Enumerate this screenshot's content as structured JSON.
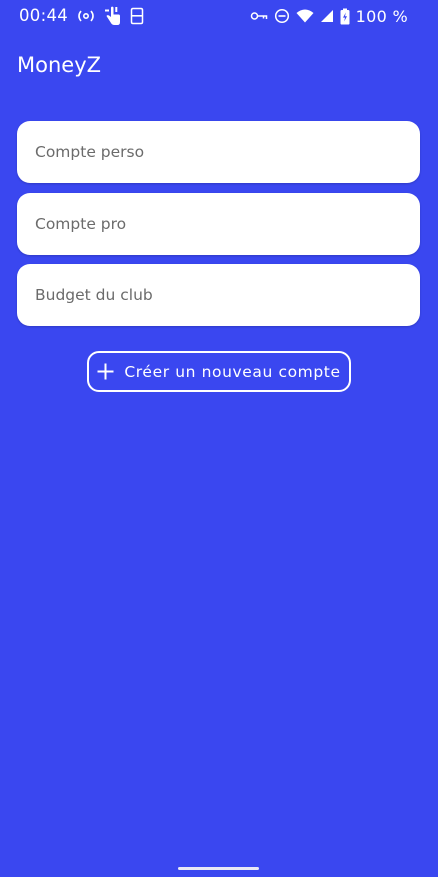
{
  "status_bar": {
    "time": "00:44",
    "battery": "100 %",
    "left_icons": [
      "radio-broadcast-icon",
      "touch-hand-icon",
      "storage-card-icon"
    ],
    "right_icons": [
      "vpn-key-icon",
      "do-not-disturb-icon",
      "wifi-icon",
      "signal-icon",
      "battery-icon"
    ]
  },
  "app": {
    "title": "MoneyZ"
  },
  "accounts": [
    {
      "name": "Compte perso"
    },
    {
      "name": "Compte pro"
    },
    {
      "name": "Budget du club"
    }
  ],
  "create_button": {
    "label": "Créer un nouveau compte",
    "icon": "plus-icon"
  },
  "colors": {
    "background": "#3a47f0",
    "card": "#ffffff",
    "card_text": "#6b6b6b",
    "foreground": "#ffffff"
  }
}
